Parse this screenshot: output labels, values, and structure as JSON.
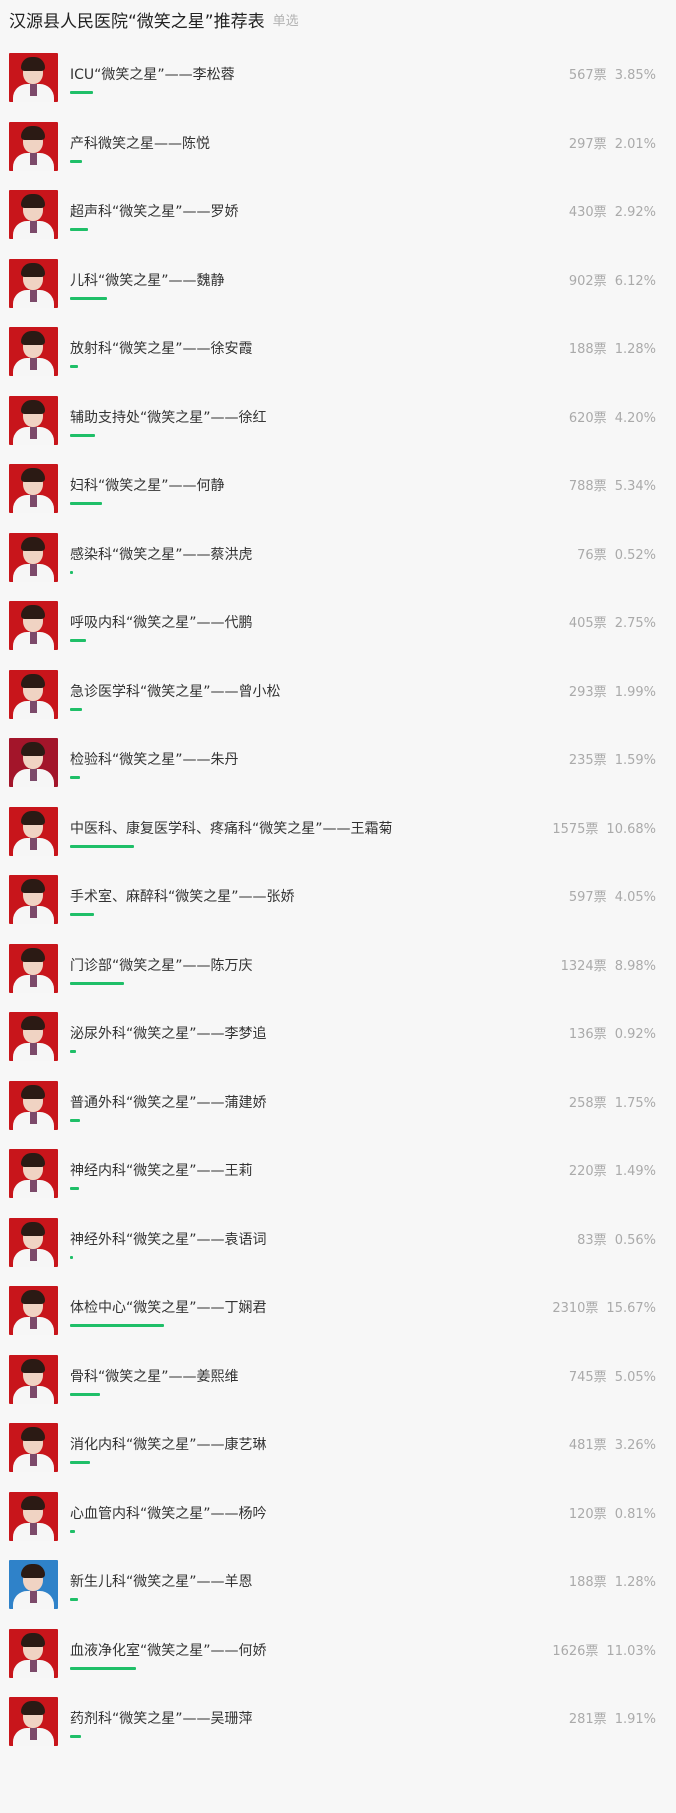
{
  "header": {
    "title": "汉源县人民医院“微笑之星”推荐表",
    "mode": "单选"
  },
  "vote_unit": "票",
  "candidates": [
    {
      "name": "ICU“微笑之星”——李松蓉",
      "votes": 567,
      "percent": "3.85%",
      "share": 3.85
    },
    {
      "name": "产科微笑之星——陈悦",
      "votes": 297,
      "percent": "2.01%",
      "share": 2.01
    },
    {
      "name": "超声科“微笑之星”——罗娇",
      "votes": 430,
      "percent": "2.92%",
      "share": 2.92
    },
    {
      "name": "儿科“微笑之星”——魏静",
      "votes": 902,
      "percent": "6.12%",
      "share": 6.12
    },
    {
      "name": "放射科“微笑之星”——徐安霞",
      "votes": 188,
      "percent": "1.28%",
      "share": 1.28
    },
    {
      "name": "辅助支持处“微笑之星”——徐红",
      "votes": 620,
      "percent": "4.20%",
      "share": 4.2
    },
    {
      "name": "妇科“微笑之星”——何静",
      "votes": 788,
      "percent": "5.34%",
      "share": 5.34
    },
    {
      "name": "感染科“微笑之星”——蔡洪虎",
      "votes": 76,
      "percent": "0.52%",
      "share": 0.52
    },
    {
      "name": "呼吸内科“微笑之星”——代鹏",
      "votes": 405,
      "percent": "2.75%",
      "share": 2.75
    },
    {
      "name": "急诊医学科“微笑之星”——曾小松",
      "votes": 293,
      "percent": "1.99%",
      "share": 1.99
    },
    {
      "name": "检验科“微笑之星”——朱丹",
      "votes": 235,
      "percent": "1.59%",
      "share": 1.59
    },
    {
      "name": "中医科、康复医学科、疼痛科“微笑之星”——王霜菊",
      "votes": 1575,
      "percent": "10.68%",
      "share": 10.68
    },
    {
      "name": "手术室、麻醉科“微笑之星”——张娇",
      "votes": 597,
      "percent": "4.05%",
      "share": 4.05
    },
    {
      "name": "门诊部“微笑之星”——陈万庆",
      "votes": 1324,
      "percent": "8.98%",
      "share": 8.98
    },
    {
      "name": "泌尿外科“微笑之星”——李梦追",
      "votes": 136,
      "percent": "0.92%",
      "share": 0.92
    },
    {
      "name": "普通外科“微笑之星”——蒲建娇",
      "votes": 258,
      "percent": "1.75%",
      "share": 1.75
    },
    {
      "name": "神经内科“微笑之星”——王莉",
      "votes": 220,
      "percent": "1.49%",
      "share": 1.49
    },
    {
      "name": "神经外科“微笑之星”——袁语词",
      "votes": 83,
      "percent": "0.56%",
      "share": 0.56
    },
    {
      "name": "体检中心“微笑之星”——丁娴君",
      "votes": 2310,
      "percent": "15.67%",
      "share": 15.67
    },
    {
      "name": "骨科“微笑之星”——姜熙维",
      "votes": 745,
      "percent": "5.05%",
      "share": 5.05
    },
    {
      "name": "消化内科“微笑之星”——康艺琳",
      "votes": 481,
      "percent": "3.26%",
      "share": 3.26
    },
    {
      "name": "心血管内科“微笑之星”——杨吟",
      "votes": 120,
      "percent": "0.81%",
      "share": 0.81
    },
    {
      "name": "新生儿科“微笑之星”——羊恩",
      "votes": 188,
      "percent": "1.28%",
      "share": 1.28
    },
    {
      "name": "血液净化室“微笑之星”——何娇",
      "votes": 1626,
      "percent": "11.03%",
      "share": 11.03
    },
    {
      "name": "药剂科“微笑之星”——吴珊萍",
      "votes": 281,
      "percent": "1.91%",
      "share": 1.91
    }
  ],
  "colors": {
    "bar": "#1fbf68",
    "avatar_bg": "#c8151b",
    "avatar_bg_alt": "#2f82c9"
  },
  "avatar_variants": [
    "red",
    "red",
    "red",
    "red",
    "red",
    "red",
    "red",
    "red",
    "red",
    "red",
    "maroon",
    "red",
    "red",
    "red",
    "red",
    "red",
    "red",
    "red",
    "red",
    "red",
    "red",
    "red",
    "blue",
    "red",
    "red"
  ]
}
